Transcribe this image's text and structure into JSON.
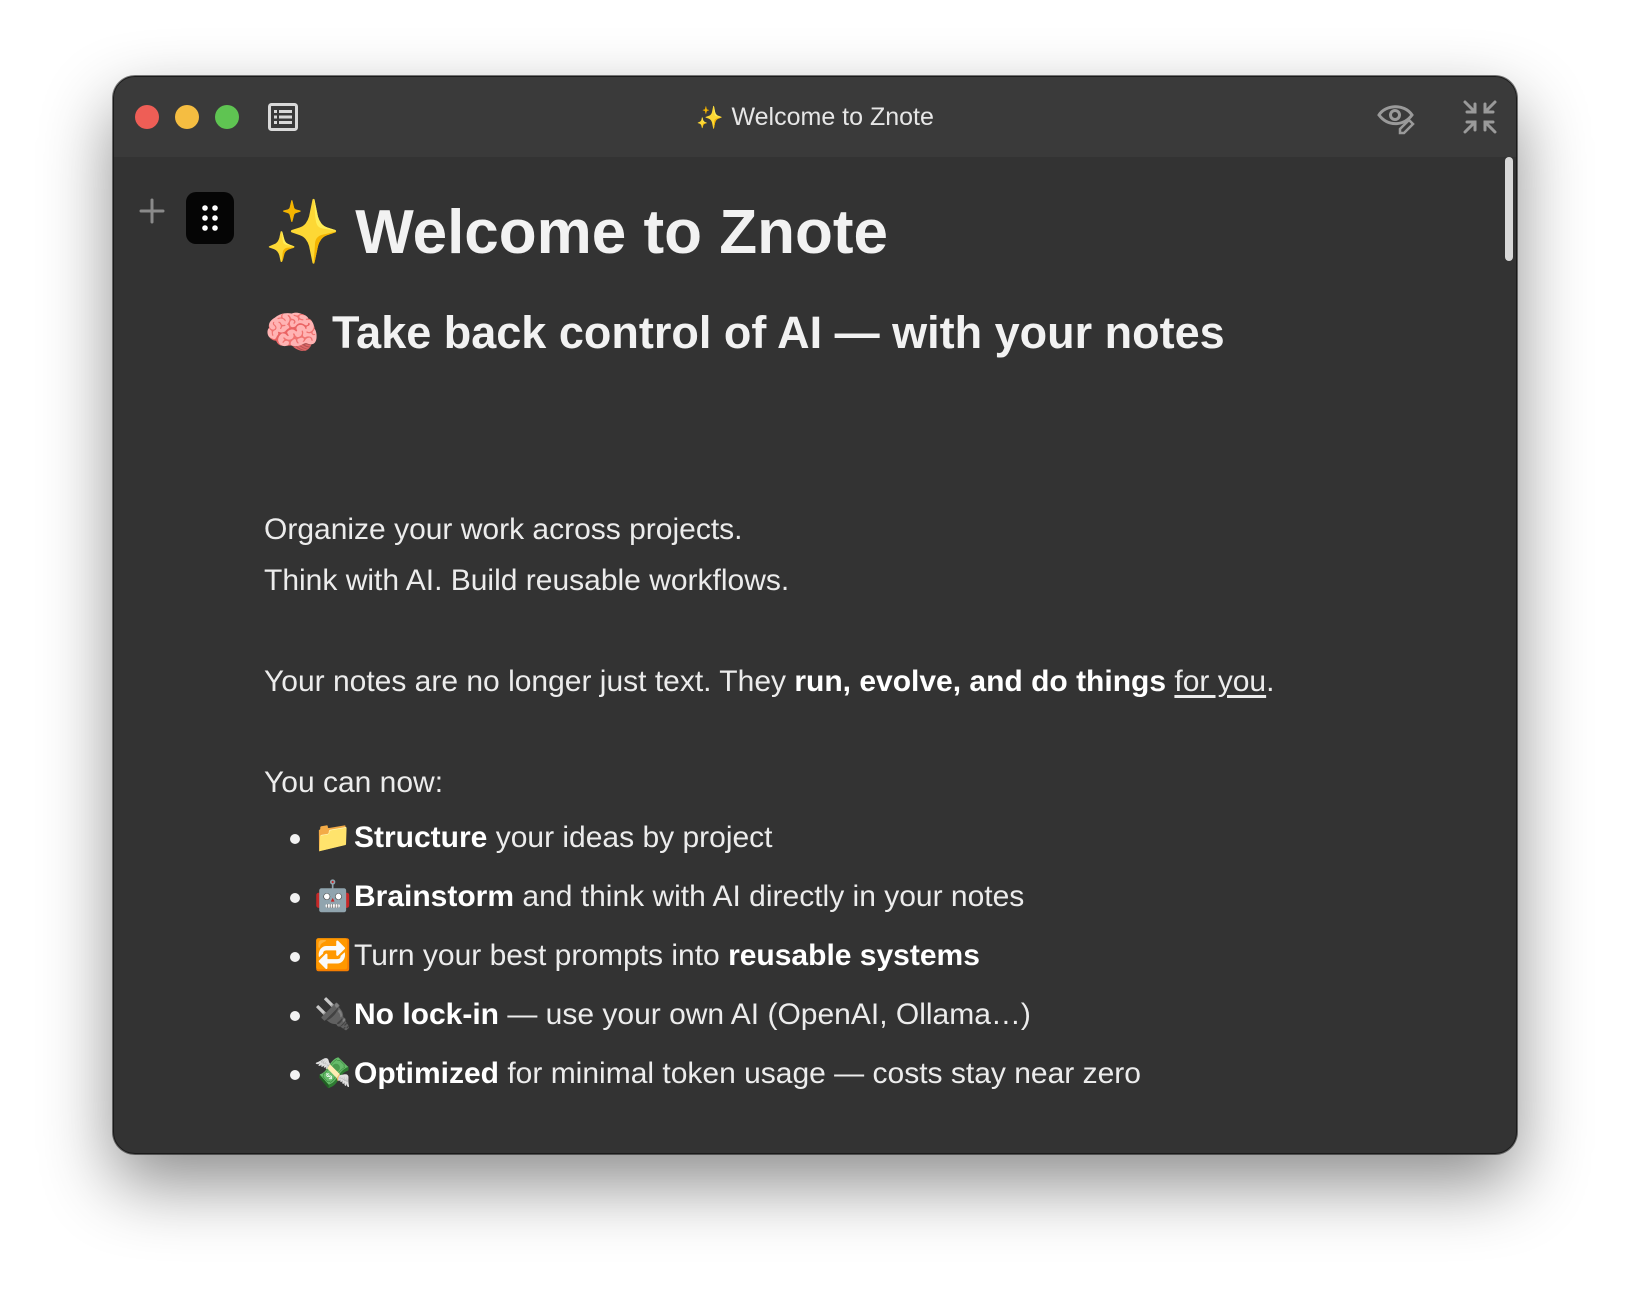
{
  "window": {
    "title_icon": "✨",
    "title": "Welcome to Znote"
  },
  "icons": {
    "sidebar_toggle": "list-icon",
    "preview": "eye-icon",
    "collapse": "collapse-icon",
    "add": "plus-icon",
    "drag": "drag-handle-icon"
  },
  "colors": {
    "window_bg": "#333333",
    "titlebar_bg": "#3a3a3a",
    "close": "#ee5e56",
    "minimize": "#f5bd41",
    "maximize": "#5fc452"
  },
  "doc": {
    "h1_emoji": "✨",
    "h1_text": "Welcome to Znote",
    "h2_emoji": "🧠",
    "h2_text": "Take back control of AI — with your notes",
    "p1": "Organize your work across projects.",
    "p2": "Think with AI. Build reusable workflows.",
    "p3_start": "Your notes are no longer just text. They ",
    "p3_bold": "run, evolve, and do things",
    "p3_space": " ",
    "p3_underline": "for you",
    "p3_end": ".",
    "p4": "You can now:",
    "list": [
      {
        "emoji": "📁",
        "a": "",
        "bold": "Structure",
        "b": " your ideas by project"
      },
      {
        "emoji": "🤖",
        "a": "",
        "bold": "Brainstorm",
        "b": " and think with AI directly in your notes"
      },
      {
        "emoji": "🔁",
        "a": "Turn your best prompts into ",
        "bold": "reusable systems",
        "b": ""
      },
      {
        "emoji": "🔌",
        "a": "",
        "bold": "No lock-in",
        "b": " — use your own AI (OpenAI, Ollama…)"
      },
      {
        "emoji": "💸",
        "a": "",
        "bold": "Optimized",
        "b": " for minimal token usage — costs stay near zero"
      }
    ]
  }
}
